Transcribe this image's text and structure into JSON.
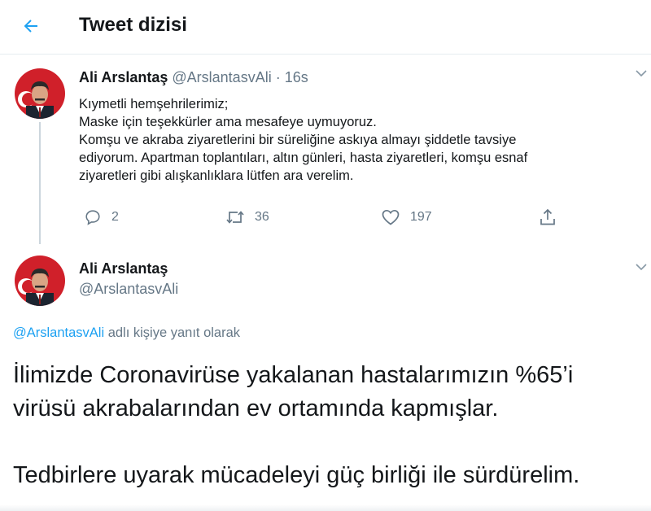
{
  "header": {
    "title": "Tweet dizisi",
    "back_icon": "arrow-left-icon",
    "accent": "#1da1f2"
  },
  "tweet1": {
    "name": "Ali Arslantaş",
    "handle": "@ArslantasvAli",
    "separator": "·",
    "time": "16s",
    "lines": [
      "Kıymetli hemşehrilerimiz;",
      "Maske için teşekkürler ama mesafeye uymuyoruz.",
      "Komşu ve akraba ziyaretlerini bir süreliğine askıya almayı şiddetle tavsiye",
      "ediyorum. Apartman toplantıları, altın günleri, hasta ziyaretleri, komşu esnaf",
      "ziyaretleri gibi alışkanlıklara lütfen ara verelim."
    ],
    "actions": {
      "reply_count": "2",
      "retweet_count": "36",
      "like_count": "197"
    }
  },
  "tweet2": {
    "name": "Ali Arslantaş",
    "handle": "@ArslantasvAli",
    "reply_to_handle": "@ArslantasvAli",
    "reply_to_suffix": " adlı kişiye yanıt olarak",
    "paragraph1_line1": "İlimizde Coronavirüse yakalanan hastalarımızın %65’i",
    "paragraph1_line2": "virüsü akrabalarından ev ortamında kapmışlar.",
    "paragraph2": "Tedbirlere uyarak mücadeleyi güç birliği ile sürdürelim."
  }
}
